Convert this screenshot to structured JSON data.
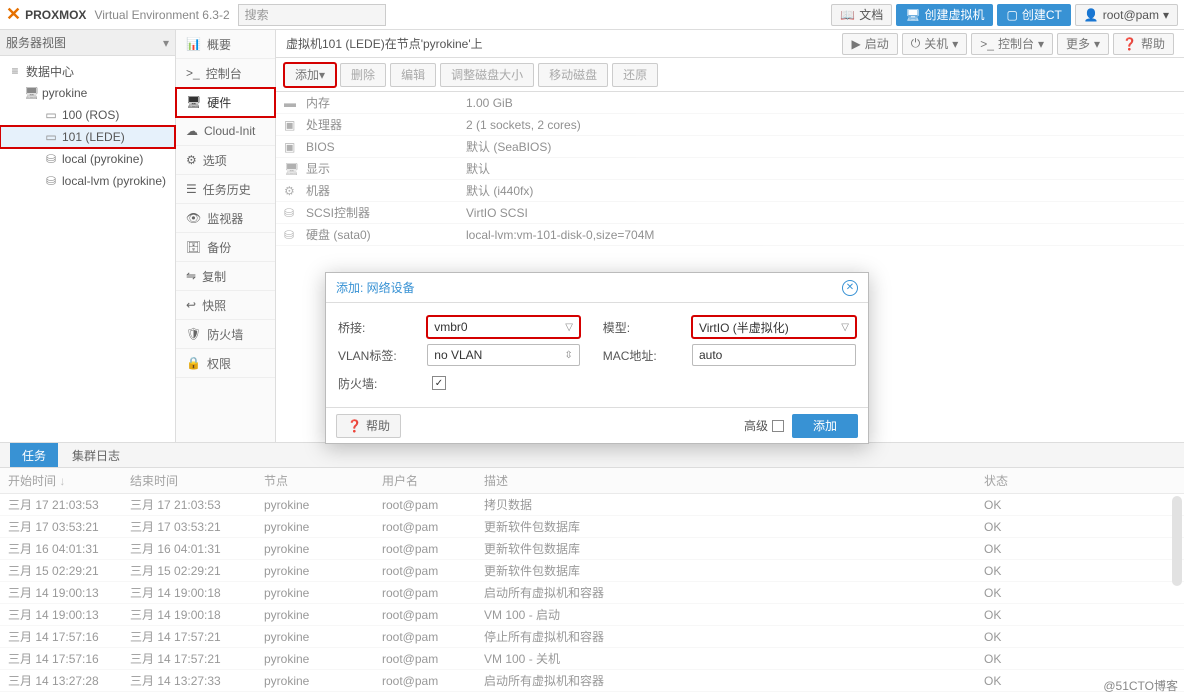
{
  "top": {
    "product": "PROXMOX",
    "subtitle": "Virtual Environment 6.3-2",
    "search_placeholder": "搜索",
    "doc": "文档",
    "create_vm": "创建虚拟机",
    "create_ct": "创建CT",
    "user": "root@pam"
  },
  "left": {
    "view": "服务器视图",
    "items": [
      {
        "icon": "≡",
        "label": "数据中心",
        "indent": 8
      },
      {
        "icon": "🖥",
        "label": "pyrokine",
        "indent": 24
      },
      {
        "icon": "▭",
        "label": "100 (ROS)",
        "indent": 44
      },
      {
        "icon": "▭",
        "label": "101 (LEDE)",
        "indent": 44,
        "selected": true,
        "hl": true
      },
      {
        "icon": "⛁",
        "label": "local (pyrokine)",
        "indent": 44
      },
      {
        "icon": "⛁",
        "label": "local-lvm (pyrokine)",
        "indent": 44
      }
    ]
  },
  "menu": [
    {
      "icon": "📊",
      "label": "概要"
    },
    {
      "icon": ">_",
      "label": "控制台"
    },
    {
      "icon": "🖥",
      "label": "硬件",
      "active": true,
      "hl": true
    },
    {
      "icon": "☁",
      "label": "Cloud-Init"
    },
    {
      "icon": "⚙",
      "label": "选项"
    },
    {
      "icon": "☰",
      "label": "任务历史"
    },
    {
      "icon": "👁",
      "label": "监视器"
    },
    {
      "icon": "🗄",
      "label": "备份"
    },
    {
      "icon": "⇋",
      "label": "复制"
    },
    {
      "icon": "↩",
      "label": "快照"
    },
    {
      "icon": "🛡",
      "label": "防火墙"
    },
    {
      "icon": "🔒",
      "label": "权限"
    }
  ],
  "crumb": {
    "text": "虚拟机101 (LEDE)在节点'pyrokine'上",
    "start": "启动",
    "shutdown": "关机",
    "console": "控制台",
    "more": "更多",
    "help": "帮助"
  },
  "toolbar": {
    "add": "添加",
    "del": "删除",
    "edit": "编辑",
    "resize": "调整磁盘大小",
    "move": "移动磁盘",
    "revert": "还原"
  },
  "hardware": [
    {
      "icon": "▬",
      "key": "内存",
      "val": "1.00 GiB"
    },
    {
      "icon": "▣",
      "key": "处理器",
      "val": "2 (1 sockets, 2 cores)"
    },
    {
      "icon": "▣",
      "key": "BIOS",
      "val": "默认 (SeaBIOS)"
    },
    {
      "icon": "🖥",
      "key": "显示",
      "val": "默认"
    },
    {
      "icon": "⚙",
      "key": "机器",
      "val": "默认 (i440fx)"
    },
    {
      "icon": "⛁",
      "key": "SCSI控制器",
      "val": "VirtIO SCSI"
    },
    {
      "icon": "⛁",
      "key": "硬盘 (sata0)",
      "val": "local-lvm:vm-101-disk-0,size=704M"
    }
  ],
  "dialog": {
    "title": "添加: 网络设备",
    "bridge_label": "桥接:",
    "bridge_val": "vmbr0",
    "model_label": "模型:",
    "model_val": "VirtIO (半虚拟化)",
    "vlan_label": "VLAN标签:",
    "vlan_val": "no VLAN",
    "mac_label": "MAC地址:",
    "mac_val": "auto",
    "fw_label": "防火墙:",
    "help": "帮助",
    "advanced": "高级",
    "add": "添加"
  },
  "tasks": {
    "tab_tasks": "任务",
    "tab_log": "集群日志",
    "cols": {
      "start": "开始时间",
      "end": "结束时间",
      "node": "节点",
      "user": "用户名",
      "desc": "描述",
      "status": "状态"
    },
    "rows": [
      {
        "start": "三月 17 21:03:53",
        "end": "三月 17 21:03:53",
        "node": "pyrokine",
        "user": "root@pam",
        "desc": "拷贝数据",
        "status": "OK"
      },
      {
        "start": "三月 17 03:53:21",
        "end": "三月 17 03:53:21",
        "node": "pyrokine",
        "user": "root@pam",
        "desc": "更新软件包数据库",
        "status": "OK"
      },
      {
        "start": "三月 16 04:01:31",
        "end": "三月 16 04:01:31",
        "node": "pyrokine",
        "user": "root@pam",
        "desc": "更新软件包数据库",
        "status": "OK"
      },
      {
        "start": "三月 15 02:29:21",
        "end": "三月 15 02:29:21",
        "node": "pyrokine",
        "user": "root@pam",
        "desc": "更新软件包数据库",
        "status": "OK"
      },
      {
        "start": "三月 14 19:00:13",
        "end": "三月 14 19:00:18",
        "node": "pyrokine",
        "user": "root@pam",
        "desc": "启动所有虚拟机和容器",
        "status": "OK"
      },
      {
        "start": "三月 14 19:00:13",
        "end": "三月 14 19:00:18",
        "node": "pyrokine",
        "user": "root@pam",
        "desc": "VM 100 - 启动",
        "status": "OK"
      },
      {
        "start": "三月 14 17:57:16",
        "end": "三月 14 17:57:21",
        "node": "pyrokine",
        "user": "root@pam",
        "desc": "停止所有虚拟机和容器",
        "status": "OK"
      },
      {
        "start": "三月 14 17:57:16",
        "end": "三月 14 17:57:21",
        "node": "pyrokine",
        "user": "root@pam",
        "desc": "VM 100 - 关机",
        "status": "OK"
      },
      {
        "start": "三月 14 13:27:28",
        "end": "三月 14 13:27:33",
        "node": "pyrokine",
        "user": "root@pam",
        "desc": "启动所有虚拟机和容器",
        "status": "OK"
      }
    ]
  },
  "watermark": "@51CTO博客"
}
